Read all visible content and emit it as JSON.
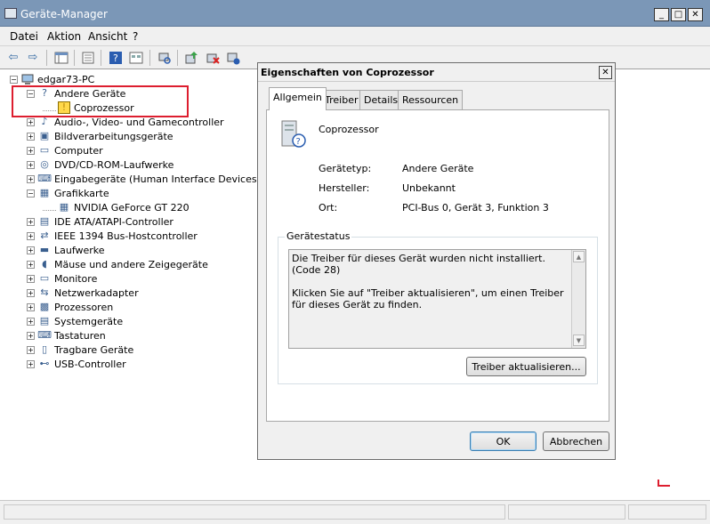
{
  "window": {
    "title": "Geräte-Manager",
    "minimize": "_",
    "maximize": "□",
    "close": "✕"
  },
  "menu": [
    "Datei",
    "Aktion",
    "Ansicht",
    "?"
  ],
  "toolbar": {
    "buttons": [
      "back-icon",
      "forward-icon",
      "show-hide-tree-icon",
      "properties-icon",
      "help-icon",
      "view-icon",
      "scan-hardware-icon",
      "update-driver-icon",
      "uninstall-icon",
      "disable-icon"
    ],
    "glyphs": {
      "back": "⇦",
      "forward": "⇨"
    }
  },
  "tree": {
    "root": "edgar73-PC",
    "items": [
      {
        "label": "Andere Geräte",
        "expanded": true
      },
      {
        "label": "Coprozessor",
        "child": true,
        "warning": true
      },
      {
        "label": "Audio-, Video- und Gamecontroller"
      },
      {
        "label": "Bildverarbeitungsgeräte"
      },
      {
        "label": "Computer"
      },
      {
        "label": "DVD/CD-ROM-Laufwerke"
      },
      {
        "label": "Eingabegeräte (Human Interface Devices)"
      },
      {
        "label": "Grafikkarte",
        "expanded": true
      },
      {
        "label": "NVIDIA GeForce GT 220",
        "child": true
      },
      {
        "label": "IDE ATA/ATAPI-Controller"
      },
      {
        "label": "IEEE 1394 Bus-Hostcontroller"
      },
      {
        "label": "Laufwerke"
      },
      {
        "label": "Mäuse und andere Zeigegeräte"
      },
      {
        "label": "Monitore"
      },
      {
        "label": "Netzwerkadapter"
      },
      {
        "label": "Prozessoren"
      },
      {
        "label": "Systemgeräte"
      },
      {
        "label": "Tastaturen"
      },
      {
        "label": "Tragbare Geräte"
      },
      {
        "label": "USB-Controller"
      }
    ]
  },
  "dialog": {
    "title": "Eigenschaften von Coprozessor",
    "close": "✕",
    "tabs": [
      "Allgemein",
      "Treiber",
      "Details",
      "Ressourcen"
    ],
    "device_name": "Coprozessor",
    "props": [
      {
        "key": "Gerätetyp:",
        "value": "Andere Geräte"
      },
      {
        "key": "Hersteller:",
        "value": "Unbekannt"
      },
      {
        "key": "Ort:",
        "value": "PCI-Bus 0, Gerät 3, Funktion 3"
      }
    ],
    "status_legend": "Gerätestatus",
    "status_line1": "Die Treiber für dieses Gerät wurden nicht installiert. (Code 28)",
    "status_line2": "Klicken Sie auf \"Treiber aktualisieren\", um einen Treiber für dieses Gerät zu finden.",
    "update_button": "Treiber aktualisieren...",
    "ok": "OK",
    "cancel": "Abbrechen"
  },
  "colors": {
    "titlebar": "#7b97b7",
    "highlight": "#dd1e2f"
  }
}
